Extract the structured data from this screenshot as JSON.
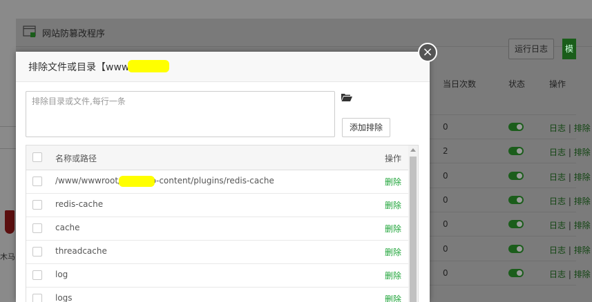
{
  "back_window": {
    "title": "网站防篡改程序",
    "run_log_label": "运行日志",
    "green_button_label": "模",
    "columns": {
      "today_count": "当日次数",
      "status": "状态",
      "action": "操作"
    },
    "rows": [
      {
        "count": "0",
        "log": "日志",
        "exclude": "排除"
      },
      {
        "count": "2",
        "log": "日志",
        "exclude": "排除"
      },
      {
        "count": "0",
        "log": "日志",
        "exclude": "排除"
      },
      {
        "count": "0",
        "log": "日志",
        "exclude": "排除"
      },
      {
        "count": "0",
        "log": "日志",
        "exclude": "排除"
      },
      {
        "count": "0",
        "log": "日志",
        "exclude": "排除"
      },
      {
        "count": "0",
        "log": "日志",
        "exclude": "排除"
      }
    ],
    "separator": "|",
    "side_text": "木马"
  },
  "modal": {
    "title": "排除文件或目录【www.        ll.com】",
    "close_label": "×",
    "input": {
      "value": "",
      "placeholder": "排除目录或文件,每行一条"
    },
    "add_button_label": "添加排除",
    "table": {
      "header_name": "名称或路径",
      "header_action": "操作",
      "rows": [
        {
          "path": "/www/wwwroot/          com/wp-content/plugins/redis-cache",
          "action": "删除"
        },
        {
          "path": "redis-cache",
          "action": "删除"
        },
        {
          "path": "cache",
          "action": "删除"
        },
        {
          "path": "threadcache",
          "action": "删除"
        },
        {
          "path": "log",
          "action": "删除"
        },
        {
          "path": "logs",
          "action": "删除"
        }
      ]
    }
  },
  "colors": {
    "accent_green": "#20a53a",
    "redaction": "#ffff00"
  }
}
